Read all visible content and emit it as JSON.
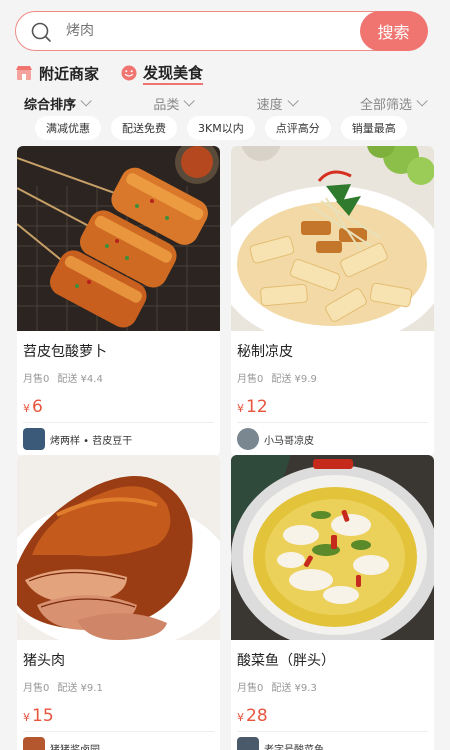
{
  "search": {
    "placeholder": "烤肉",
    "button_label": "搜索"
  },
  "sections": [
    {
      "label": "附近商家",
      "icon": "shop-icon",
      "active": false
    },
    {
      "label": "发现美食",
      "icon": "smile-icon",
      "active": true
    }
  ],
  "sort_bar": [
    {
      "label": "综合排序"
    },
    {
      "label": "品类"
    },
    {
      "label": "速度"
    },
    {
      "label": "全部筛选"
    }
  ],
  "filter_chips": [
    "满减优惠",
    "配送免费",
    "3KM以内",
    "点评高分",
    "销量最高"
  ],
  "colors": {
    "accent": "#f07470",
    "price": "#e8553f"
  },
  "cards": [
    {
      "name": "苕皮包酸萝卜",
      "monthly_sales": "月售0",
      "delivery_fee": "配送 ¥4.4",
      "price_symbol": "¥",
      "price": "6",
      "shop": "烤两样 • 苕皮豆干",
      "image": "skewers-photo"
    },
    {
      "name": "秘制凉皮",
      "monthly_sales": "月售0",
      "delivery_fee": "配送 ¥9.9",
      "price_symbol": "¥",
      "price": "12",
      "shop": "小马哥凉皮",
      "image": "noodles-photo"
    },
    {
      "name": "猪头肉",
      "monthly_sales": "月售0",
      "delivery_fee": "配送 ¥9.1",
      "price_symbol": "¥",
      "price": "15",
      "shop": "猪猪酱卤园",
      "image": "braised-pork-photo"
    },
    {
      "name": "酸菜鱼（胖头）",
      "monthly_sales": "月售0",
      "delivery_fee": "配送 ¥9.3",
      "price_symbol": "¥",
      "price": "28",
      "shop": "老字号酸菜鱼",
      "image": "fish-soup-photo"
    }
  ]
}
